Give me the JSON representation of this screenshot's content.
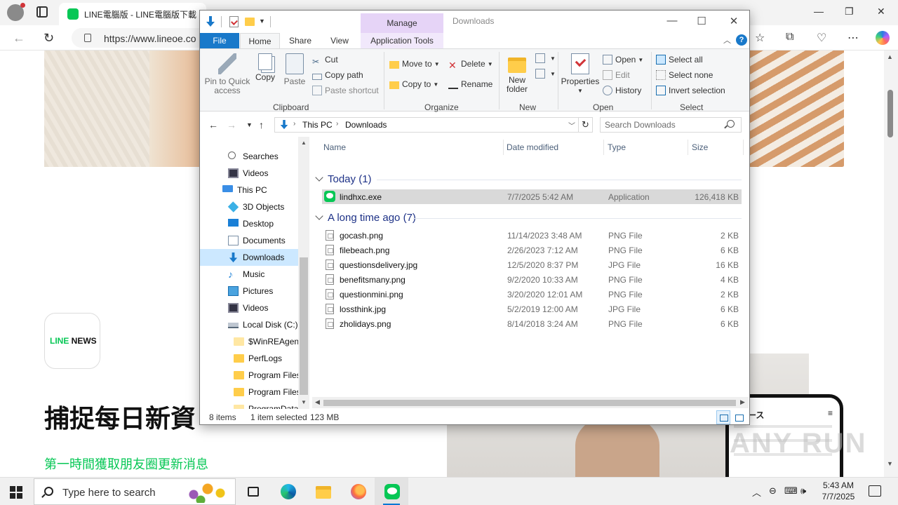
{
  "browser": {
    "tab_title": "LINE電腦版 - LINE電腦版下載",
    "url": "https://www.lineoe.co",
    "page": {
      "logo_line": "LINE",
      "logo_news": " NEWS",
      "heading": "捕捉每日新資",
      "subheading": "第一時間獲取朋友圈更新消息",
      "phone_title": "ース",
      "watermark": "ANY RUN"
    }
  },
  "explorer": {
    "window_title": "Downloads",
    "contextual_header": "Manage",
    "tabs": {
      "file": "File",
      "home": "Home",
      "share": "Share",
      "view": "View",
      "app_tools": "Application Tools"
    },
    "ribbon": {
      "clipboard": {
        "label": "Clipboard",
        "pin": "Pin to Quick access",
        "pin_l1": "Pin to Quick",
        "pin_l2": "access",
        "copy": "Copy",
        "paste": "Paste",
        "cut": "Cut",
        "copy_path": "Copy path",
        "paste_shortcut": "Paste shortcut"
      },
      "organize": {
        "label": "Organize",
        "move_to": "Move to",
        "copy_to": "Copy to",
        "delete": "Delete",
        "rename": "Rename"
      },
      "new": {
        "label": "New",
        "new_folder_l1": "New",
        "new_folder_l2": "folder"
      },
      "open": {
        "label": "Open",
        "properties": "Properties",
        "open": "Open",
        "edit": "Edit",
        "history": "History"
      },
      "select": {
        "label": "Select",
        "select_all": "Select all",
        "select_none": "Select none",
        "invert": "Invert selection"
      }
    },
    "address": {
      "crumbs": [
        "This PC",
        "Downloads"
      ],
      "search_placeholder": "Search Downloads"
    },
    "nav_items": [
      {
        "label": "Searches",
        "icon": "search-icon",
        "indent": 1
      },
      {
        "label": "Videos",
        "icon": "videos-icon",
        "indent": 1
      },
      {
        "label": "This PC",
        "icon": "computer-icon",
        "indent": 0
      },
      {
        "label": "3D Objects",
        "icon": "cube-icon",
        "indent": 1
      },
      {
        "label": "Desktop",
        "icon": "desktop-icon",
        "indent": 1
      },
      {
        "label": "Documents",
        "icon": "documents-icon",
        "indent": 1
      },
      {
        "label": "Downloads",
        "icon": "download-arrow-icon",
        "indent": 1,
        "selected": true
      },
      {
        "label": "Music",
        "icon": "music-note-icon",
        "indent": 1
      },
      {
        "label": "Pictures",
        "icon": "pictures-icon",
        "indent": 1
      },
      {
        "label": "Videos",
        "icon": "videos-icon",
        "indent": 1
      },
      {
        "label": "Local Disk (C:)",
        "icon": "drive-icon",
        "indent": 1
      },
      {
        "label": "$WinREAgent",
        "icon": "folder-icon",
        "indent": 2,
        "light": true
      },
      {
        "label": "PerfLogs",
        "icon": "folder-icon",
        "indent": 2
      },
      {
        "label": "Program Files",
        "icon": "folder-icon",
        "indent": 2
      },
      {
        "label": "Program Files",
        "icon": "folder-icon",
        "indent": 2
      },
      {
        "label": "ProgramData",
        "icon": "folder-icon",
        "indent": 2,
        "light": true
      }
    ],
    "columns": {
      "name": "Name",
      "date": "Date modified",
      "type": "Type",
      "size": "Size"
    },
    "groups": [
      {
        "title": "Today (1)",
        "files": [
          {
            "name": "lindhxc.exe",
            "date": "7/7/2025 5:42 AM",
            "type": "Application",
            "size": "126,418 KB",
            "selected": true,
            "exe": true
          }
        ]
      },
      {
        "title": "A long time ago (7)",
        "files": [
          {
            "name": "gocash.png",
            "date": "11/14/2023 3:48 AM",
            "type": "PNG File",
            "size": "2 KB"
          },
          {
            "name": "filebeach.png",
            "date": "2/26/2023 7:12 AM",
            "type": "PNG File",
            "size": "6 KB"
          },
          {
            "name": "questionsdelivery.jpg",
            "date": "12/5/2020 8:37 PM",
            "type": "JPG File",
            "size": "16 KB"
          },
          {
            "name": "benefitsmany.png",
            "date": "9/2/2020 10:33 AM",
            "type": "PNG File",
            "size": "4 KB"
          },
          {
            "name": "questionmini.png",
            "date": "3/20/2020 12:01 AM",
            "type": "PNG File",
            "size": "2 KB"
          },
          {
            "name": "lossthink.jpg",
            "date": "5/2/2019 12:00 AM",
            "type": "JPG File",
            "size": "6 KB"
          },
          {
            "name": "zholidays.png",
            "date": "8/14/2018 3:24 AM",
            "type": "PNG File",
            "size": "6 KB"
          }
        ]
      }
    ],
    "status": {
      "items": "8 items",
      "selected": "1 item selected",
      "size": "123 MB"
    }
  },
  "taskbar": {
    "search_placeholder": "Type here to search",
    "time": "5:43 AM",
    "date": "7/7/2025",
    "accent": "#0078d4"
  }
}
